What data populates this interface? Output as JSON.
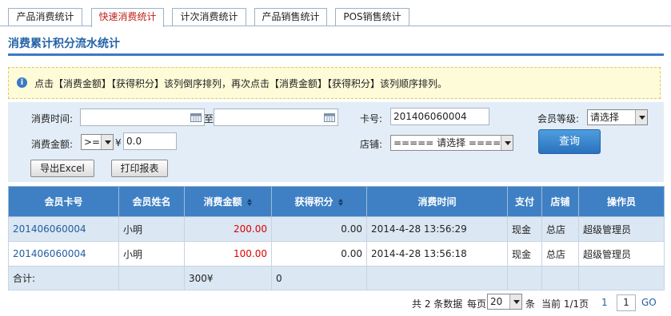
{
  "tabs": [
    {
      "label": "产品消费统计",
      "active": false
    },
    {
      "label": "快速消费统计",
      "active": true
    },
    {
      "label": "计次消费统计",
      "active": false
    },
    {
      "label": "产品销售统计",
      "active": false
    },
    {
      "label": "POS销售统计",
      "active": false
    }
  ],
  "section_title": "消费累计积分流水统计",
  "info_text": "点击【消费金额】【获得积分】该列倒序排列，再次点击【消费金额】【获得积分】该列顺序排列。",
  "search": {
    "time_label": "消费时间:",
    "time_from": "",
    "to_label": "至",
    "time_to": "",
    "card_label": "卡号:",
    "card_value": "201406060004",
    "level_label": "会员等级:",
    "level_value": "请选择",
    "amount_label": "消费金额:",
    "amount_op": ">=",
    "currency": "¥",
    "amount_value": "0.0",
    "store_label": "店铺:",
    "store_value": "===== 请选择 =====",
    "query_button": "查询",
    "export_button": "导出Excel",
    "print_button": "打印报表"
  },
  "table": {
    "headers": [
      "会员卡号",
      "会员姓名",
      "消费金额",
      "获得积分",
      "消费时间",
      "支付",
      "店铺",
      "操作员"
    ],
    "rows": [
      {
        "card": "201406060004",
        "name": "小明",
        "amount": "200.00",
        "points": "0.00",
        "time": "2014-4-28 13:56:29",
        "pay": "现金",
        "store": "总店",
        "operator": "超级管理员"
      },
      {
        "card": "201406060004",
        "name": "小明",
        "amount": "100.00",
        "points": "0.00",
        "time": "2014-4-28 13:56:18",
        "pay": "现金",
        "store": "总店",
        "operator": "超级管理员"
      }
    ],
    "summary": {
      "label": "合计:",
      "amount": "300¥",
      "points": "0"
    }
  },
  "pager": {
    "total_text": "共 2 条数据",
    "per_page_label": "每页",
    "per_page_value": "20",
    "per_page_unit": "条",
    "current_text": "当前 1/1页",
    "page_link": "1",
    "page_input": "1",
    "go_label": "GO"
  }
}
